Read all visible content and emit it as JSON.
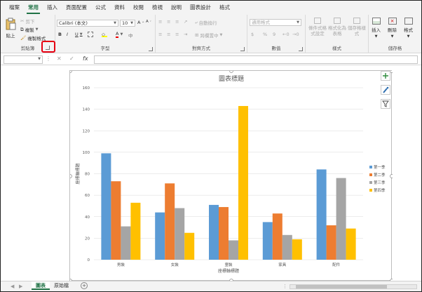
{
  "ribbon_tabs": [
    "檔案",
    "常用",
    "插入",
    "頁面配置",
    "公式",
    "資料",
    "校閱",
    "檢視",
    "說明",
    "圖表設計",
    "格式"
  ],
  "active_tab_index": 1,
  "clipboard": {
    "paste": "貼上",
    "cut": "剪下",
    "copy": "複製",
    "format_painter": "複製格式",
    "label": "剪貼簿"
  },
  "font": {
    "name": "Calibri (本文)",
    "size": "10",
    "bold": "B",
    "italic": "I",
    "underline": "U",
    "label": "字型",
    "grow": "A^",
    "shrink": "A˅"
  },
  "alignment": {
    "wrap": "自動換行",
    "merge": "跨欄置中",
    "label": "對齊方式"
  },
  "number": {
    "format": "通用格式",
    "currency": "$",
    "percent": "%",
    "comma": "9",
    "label": "數值"
  },
  "styles": {
    "cond": "條件式格式設定",
    "table": "格式化為表格",
    "cell": "儲存格樣式",
    "label": "樣式"
  },
  "cells": {
    "insert": "插入",
    "delete": "刪除",
    "format": "格式",
    "label": "儲存格"
  },
  "formula_bar": {
    "fx": "fx",
    "cancel": "✕",
    "enter": "✓"
  },
  "chart_data": {
    "type": "bar",
    "title": "圖表標題",
    "categories": [
      "男裝",
      "女裝",
      "童裝",
      "家具",
      "配件"
    ],
    "series": [
      {
        "name": "第一季",
        "values": [
          99,
          44,
          51,
          35,
          84
        ],
        "color": "#5b9bd5"
      },
      {
        "name": "第二季",
        "values": [
          73,
          71,
          49,
          43,
          32
        ],
        "color": "#ed7d31"
      },
      {
        "name": "第三季",
        "values": [
          31,
          48,
          18,
          23,
          76
        ],
        "color": "#a5a5a5"
      },
      {
        "name": "第四季",
        "values": [
          53,
          25,
          143,
          19,
          29
        ],
        "color": "#ffc000"
      }
    ],
    "xlabel": "座標軸標題",
    "ylabel": "座標軸標題",
    "ylim": [
      0,
      160
    ],
    "yticks": [
      0,
      20,
      40,
      60,
      80,
      100,
      120,
      140,
      160
    ],
    "grid": true,
    "legend": "right"
  },
  "chart_tools": {
    "add": "+",
    "brush": "brush-icon",
    "filter": "filter-icon"
  },
  "sheets": [
    "圖表",
    "原始檔"
  ],
  "active_sheet_index": 0,
  "new_sheet": "+"
}
